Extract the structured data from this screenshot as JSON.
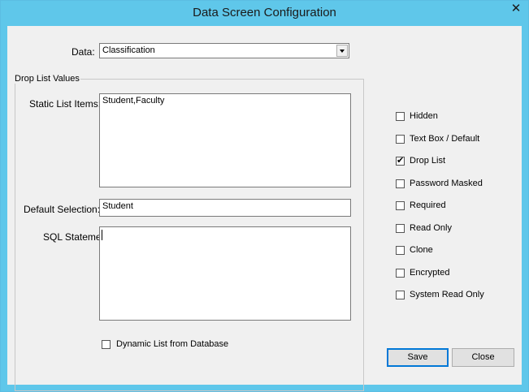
{
  "window": {
    "title": "Data Screen Configuration",
    "close_glyph": "✕"
  },
  "data_field": {
    "label": "Data:",
    "value": "Classification"
  },
  "group": {
    "title": "Drop List Values",
    "static_label": "Static List Items:",
    "static_value": "Student,Faculty",
    "default_label": "Default Selection:",
    "default_value": "Student",
    "sql_label": "SQL Statement:",
    "sql_value": "",
    "dynamic_label": "Dynamic List from Database",
    "dynamic_checked": false
  },
  "options": [
    {
      "label": "Hidden",
      "checked": false
    },
    {
      "label": "Text Box / Default",
      "checked": false
    },
    {
      "label": "Drop List",
      "checked": true
    },
    {
      "label": "Password Masked",
      "checked": false
    },
    {
      "label": "Required",
      "checked": false
    },
    {
      "label": "Read Only",
      "checked": false
    },
    {
      "label": "Clone",
      "checked": false
    },
    {
      "label": "Encrypted",
      "checked": false
    },
    {
      "label": "System Read Only",
      "checked": false
    }
  ],
  "buttons": {
    "save": "Save",
    "close": "Close"
  }
}
